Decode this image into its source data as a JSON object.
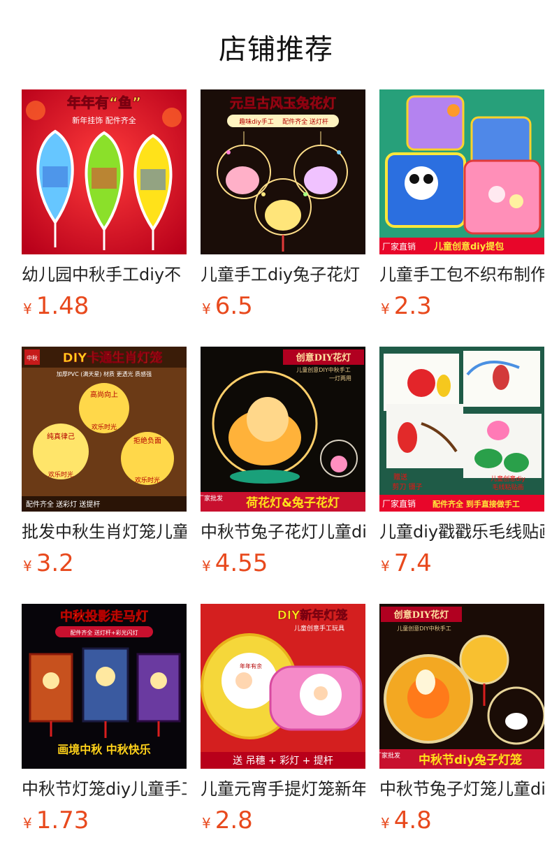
{
  "header": {
    "title": "店铺推荐"
  },
  "currency": "¥",
  "products": [
    {
      "name": "幼儿园中秋手工diy不",
      "price": "1.48",
      "thumb_text": [
        "年年有“鱼”",
        "新年挂饰 配件齐全"
      ]
    },
    {
      "name": "儿童手工diy兔子花灯",
      "price": "6.5",
      "thumb_text": [
        "元旦古风玉兔花灯",
        "趣味diy手工",
        "配件齐全 送灯杆"
      ]
    },
    {
      "name": "儿童手工包不织布制作",
      "price": "2.3",
      "thumb_text": [
        "厂家直销",
        "儿童创意diy提包"
      ]
    },
    {
      "name": "批发中秋生肖灯笼儿童",
      "price": "3.2",
      "thumb_text": [
        "中秋",
        "DIY卡通生肖灯笼",
        "加厚PVC (满天星) 材质 更透光 质感强",
        "高尚向上",
        "欢乐时光",
        "纯真律己",
        "欢乐时光",
        "拒绝负面",
        "欢乐时光",
        "配件齐全 送彩灯 送提杆"
      ]
    },
    {
      "name": "中秋节兔子花灯儿童diy",
      "price": "4.55",
      "thumb_text": [
        "创意DIY花灯",
        "儿童创意DIY中秋手工",
        "一灯两用",
        "厂家批发",
        "荷花灯&兔子花灯"
      ]
    },
    {
      "name": "儿童diy戳戳乐毛线贴画",
      "price": "7.4",
      "thumb_text": [
        "赠送",
        "剪刀 镊子",
        "儿童创意diy",
        "毛线粘贴画",
        "厂家直销",
        "配件齐全 到手直接做手工"
      ]
    },
    {
      "name": "中秋节灯笼diy儿童手工",
      "price": "1.73",
      "thumb_text": [
        "中秋投影走马灯",
        "配件齐全 送灯杆+彩光闪灯",
        "画境中秋 中秋快乐"
      ]
    },
    {
      "name": "儿童元宵手提灯笼新年",
      "price": "2.8",
      "thumb_text": [
        "DIY新年灯笼",
        "儿童创意手工玩具",
        "年年有余",
        "送 吊穗 + 彩灯 + 提杆"
      ]
    },
    {
      "name": "中秋节兔子灯笼儿童diy",
      "price": "4.8",
      "thumb_text": [
        "创意DIY花灯",
        "儿童创意DIY中秋手工",
        "厂家批发",
        "中秋节diy兔子灯笼"
      ]
    }
  ]
}
